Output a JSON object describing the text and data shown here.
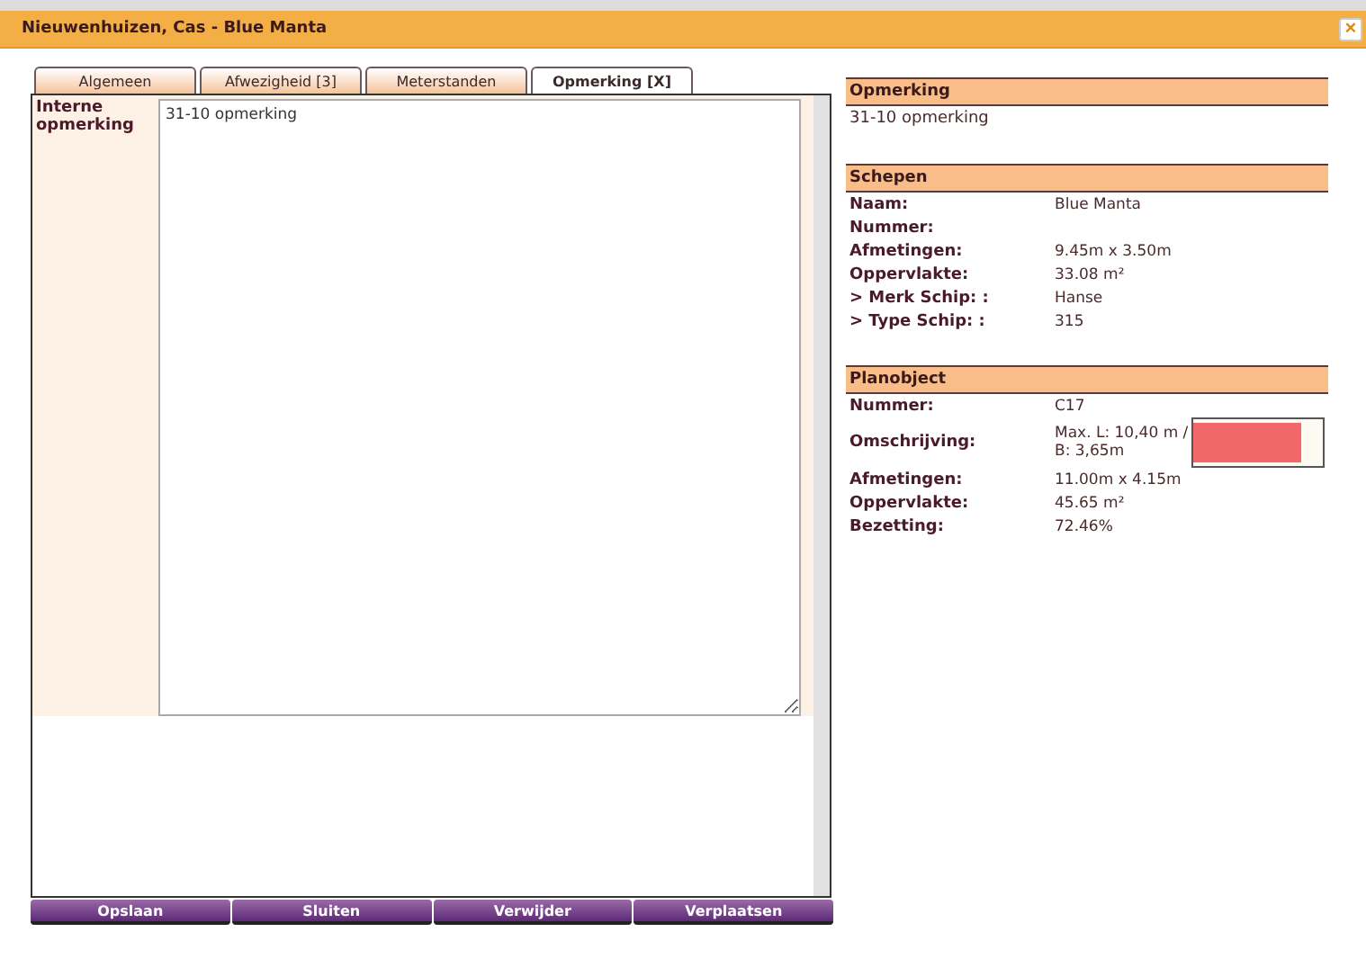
{
  "window": {
    "title": "Nieuwenhuizen, Cas - Blue Manta",
    "close": "×"
  },
  "tabs": [
    {
      "label": "Algemeen",
      "selected": false
    },
    {
      "label": "Afwezigheid [3]",
      "selected": false
    },
    {
      "label": "Meterstanden",
      "selected": false
    },
    {
      "label": "Opmerking [X]",
      "selected": true
    }
  ],
  "form": {
    "label": "Interne opmerking",
    "value": "31-10 opmerking"
  },
  "buttons": [
    "Opslaan",
    "Sluiten",
    "Verwijder",
    "Verplaatsen"
  ],
  "sections": [
    {
      "title": "Opmerking",
      "text": "31-10 opmerking"
    },
    {
      "title": "Schepen",
      "rows": [
        {
          "label": "Naam:",
          "value": "Blue Manta"
        },
        {
          "label": "Nummer:"
        },
        {
          "label": "Afmetingen:",
          "value": "9.45m x 3.50m"
        },
        {
          "label": "Oppervlakte:",
          "value": "33.08 m²"
        },
        {
          "label": "> Merk Schip: :",
          "value": "Hanse"
        },
        {
          "label": "> Type Schip: :",
          "value": "315"
        }
      ]
    },
    {
      "title": "Planobject",
      "rows": [
        {
          "label": "Nummer:",
          "value": "C17"
        },
        {
          "label": "Omschrijving:",
          "value": "Max. L: 10,40 m / B: 3,65m",
          "level": 0.84
        },
        {
          "label": "Afmetingen:",
          "value": "11.00m x 4.15m"
        },
        {
          "label": "Oppervlakte:",
          "value": "45.65 m²"
        },
        {
          "label": "Bezetting:",
          "value": "72.46%"
        }
      ]
    }
  ]
}
